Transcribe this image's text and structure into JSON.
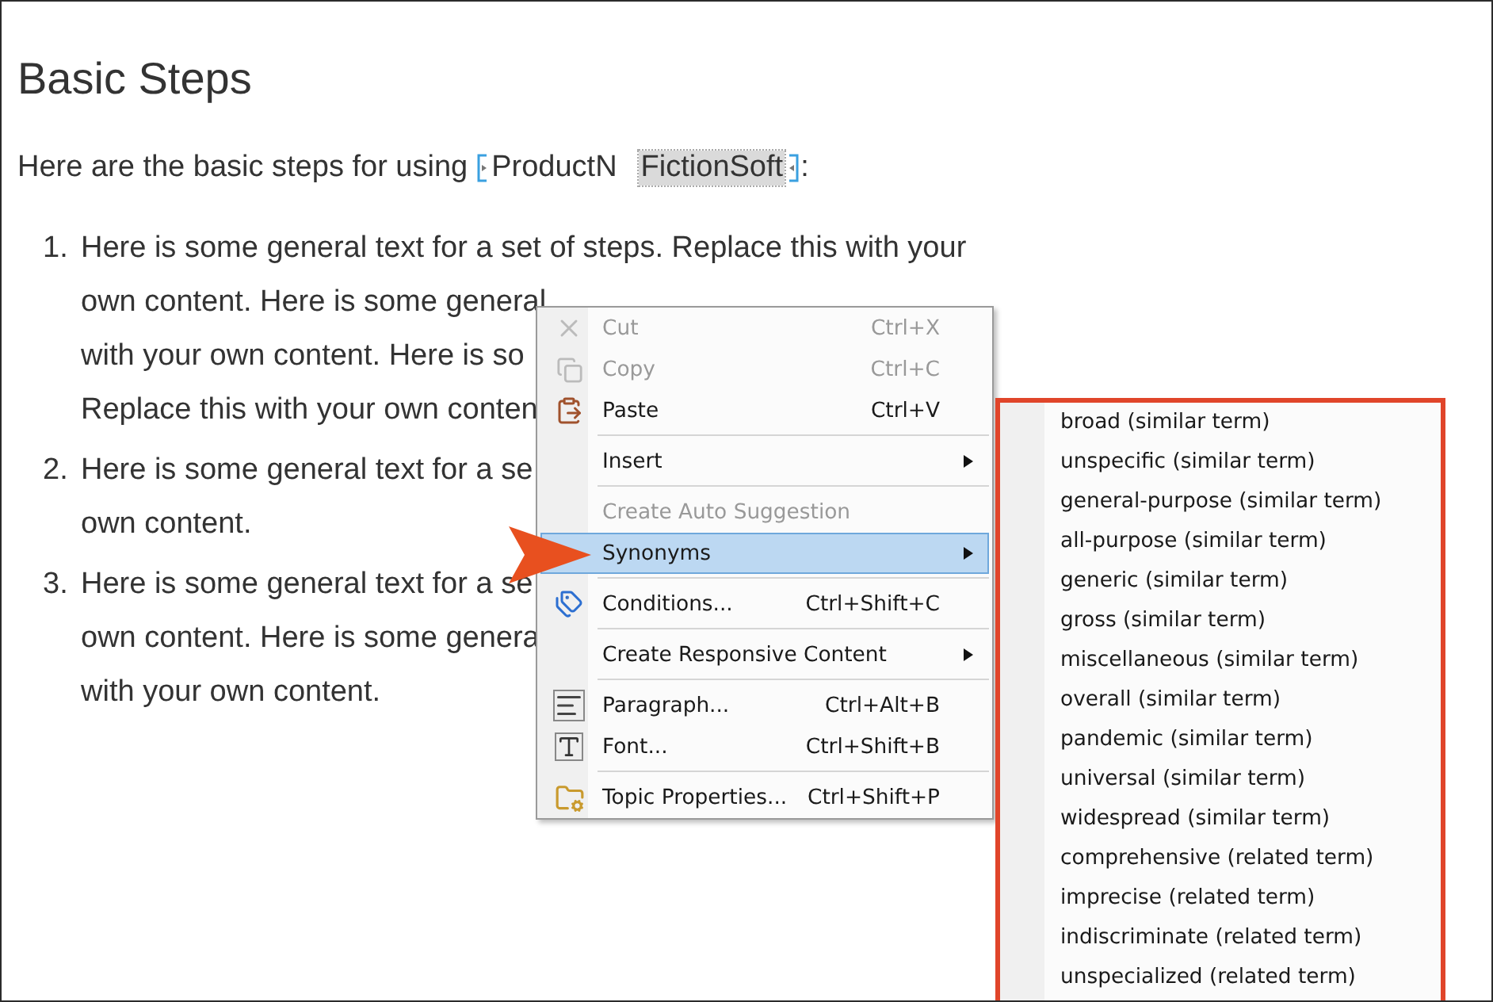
{
  "document": {
    "heading": "Basic Steps",
    "intro": {
      "text": "Here are the basic steps for using",
      "variable_name": "ProductN",
      "variable_value": "FictionSoft",
      "suffix": ":"
    },
    "steps": [
      {
        "number": "1.",
        "lines": [
          "Here is some general text for a set of steps. Replace this with your",
          "own content. Here is some general",
          "with your own content. Here is so",
          "Replace this with your own conten"
        ]
      },
      {
        "number": "2.",
        "lines": [
          "Here is some general text for a se",
          "own content."
        ]
      },
      {
        "number": "3.",
        "lines": [
          "Here is some general text for a se",
          "own content. Here is some genera",
          "with your own content."
        ]
      }
    ]
  },
  "context_menu": {
    "items": [
      {
        "kind": "item",
        "label": "Cut",
        "shortcut": "Ctrl+X",
        "disabled": true,
        "selected": false,
        "submenu": false
      },
      {
        "kind": "item",
        "label": "Copy",
        "shortcut": "Ctrl+C",
        "disabled": true,
        "selected": false,
        "submenu": false
      },
      {
        "kind": "item",
        "label": "Paste",
        "shortcut": "Ctrl+V",
        "disabled": false,
        "selected": false,
        "submenu": false
      },
      {
        "kind": "separator"
      },
      {
        "kind": "item",
        "label": "Insert",
        "disabled": false,
        "selected": false,
        "submenu": true
      },
      {
        "kind": "separator"
      },
      {
        "kind": "item",
        "label": "Create Auto Suggestion",
        "disabled": true,
        "selected": false,
        "submenu": false
      },
      {
        "kind": "item",
        "label": "Synonyms",
        "disabled": false,
        "selected": true,
        "submenu": true
      },
      {
        "kind": "separator"
      },
      {
        "kind": "item",
        "label": "Conditions...",
        "shortcut": "Ctrl+Shift+C",
        "disabled": false,
        "selected": false,
        "submenu": false
      },
      {
        "kind": "separator"
      },
      {
        "kind": "item",
        "label": "Create Responsive Content",
        "disabled": false,
        "selected": false,
        "submenu": true
      },
      {
        "kind": "separator"
      },
      {
        "kind": "item",
        "label": "Paragraph...",
        "shortcut": "Ctrl+Alt+B",
        "disabled": false,
        "selected": false,
        "submenu": false
      },
      {
        "kind": "item",
        "label": "Font...",
        "shortcut": "Ctrl+Shift+B",
        "disabled": false,
        "selected": false,
        "submenu": false
      },
      {
        "kind": "separator"
      },
      {
        "kind": "item",
        "label": "Topic Properties...",
        "shortcut": "Ctrl+Shift+P",
        "disabled": false,
        "selected": false,
        "submenu": false
      }
    ]
  },
  "synonyms_menu": {
    "items": [
      "broad (similar term)",
      "unspecific (similar term)",
      "general-purpose (similar term)",
      "all-purpose (similar term)",
      "generic (similar term)",
      "gross (similar term)",
      "miscellaneous (similar term)",
      "overall (similar term)",
      "pandemic (similar term)",
      "universal (similar term)",
      "widespread (similar term)",
      "comprehensive (related term)",
      "imprecise (related term)",
      "indiscriminate (related term)",
      "unspecialized (related term)"
    ]
  }
}
